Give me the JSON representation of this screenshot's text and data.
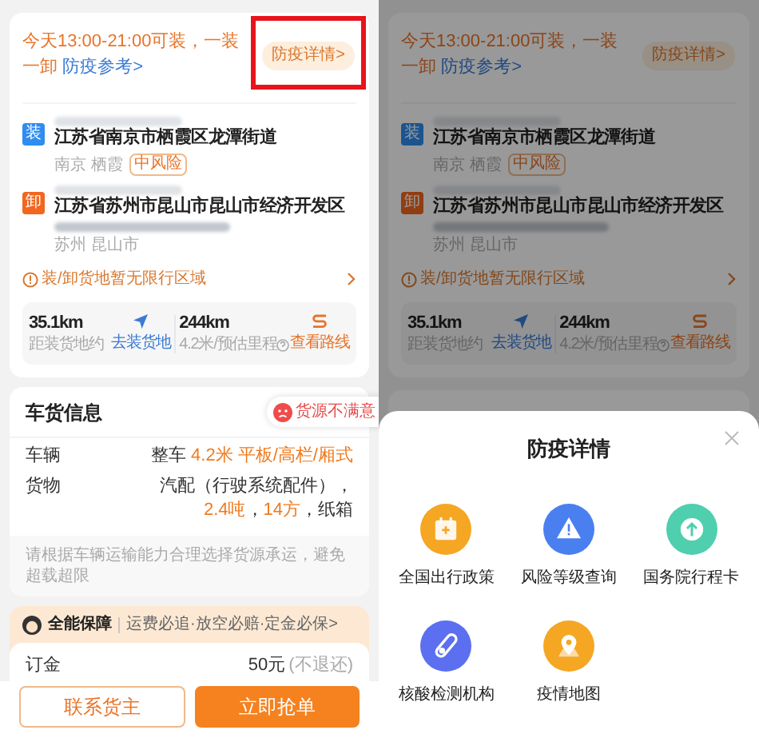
{
  "left": {
    "route_card": {
      "time_text": "今天13:00-21:00可装，一装一卸 ",
      "reference_link": "防疫参考>",
      "epidemic_badge": {
        "label": "防疫详情>",
        "highlighted": true
      },
      "stops": [
        {
          "kind": "load",
          "tag": "装",
          "address": "江苏省南京市栖霞区龙潭街道",
          "area": "南京 栖霞",
          "risk": "中风险"
        },
        {
          "kind": "unload",
          "tag": "卸",
          "address": "江苏省苏州市昆山市昆山市经济开发区",
          "area": "苏州 昆山市"
        }
      ],
      "notice": "装/卸货地暂无限行区域",
      "stats": {
        "distance": "35.1km",
        "distance_label": "距装货地约",
        "navigate": "去装货地",
        "mileage": "244km",
        "mileage_label": "4.2米/预估里程",
        "route": "查看路线"
      }
    },
    "cargo_card": {
      "title": "车货信息",
      "feedback": "货源不满意",
      "rows": [
        {
          "label": "车辆",
          "value": [
            {
              "text": "整车 ",
              "accent": false
            },
            {
              "text": "4.2米 平板/高栏/厢式",
              "accent": true
            }
          ]
        },
        {
          "label": "货物",
          "value": [
            {
              "text": "汽配（行驶系统配件），",
              "accent": false
            },
            {
              "text": "2.4吨",
              "accent": true
            },
            {
              "text": "，",
              "accent": false
            },
            {
              "text": "14方",
              "accent": true
            },
            {
              "text": "，纸箱",
              "accent": false
            }
          ]
        }
      ],
      "note": "请根据车辆运输能力合理选择货源承运，避免超载超限"
    },
    "guarantee": {
      "title": "全能保障",
      "slogan": "运费必追·放空必赔·定金必保>",
      "deposit_label": "订金",
      "deposit_value": "50元",
      "deposit_note": "(不退还)"
    },
    "buttons": [
      {
        "kind": "outline",
        "label": "联系货主"
      },
      {
        "kind": "primary",
        "label": "立即抢单"
      }
    ]
  },
  "right": {
    "route_card": {
      "time_text": "今天13:00-21:00可装，一装一卸 ",
      "reference_link": "防疫参考>",
      "epidemic_badge": {
        "label": "防疫详情>",
        "highlighted": false
      },
      "stops": [
        {
          "kind": "load",
          "tag": "装",
          "address": "江苏省南京市栖霞区龙潭街道",
          "area": "南京 栖霞",
          "risk": "中风险"
        },
        {
          "kind": "unload",
          "tag": "卸",
          "address": "江苏省苏州市昆山市昆山市经济开发区",
          "area": "苏州 昆山市"
        }
      ],
      "notice": "装/卸货地暂无限行区域",
      "stats": {
        "distance": "35.1km",
        "distance_label": "距装货地约",
        "navigate": "去装货地",
        "mileage": "244km",
        "mileage_label": "4.2米/预估里程",
        "route": "查看路线"
      }
    },
    "sheet": {
      "title": "防疫详情",
      "items": [
        {
          "kind": "calendar",
          "label": "全国出行政策",
          "color": "#f5a623"
        },
        {
          "kind": "warning",
          "label": "风险等级查询",
          "color": "#4a7ff0"
        },
        {
          "kind": "arrow",
          "label": "国务院行程卡",
          "color": "#4fcfae"
        },
        {
          "kind": "tube",
          "label": "核酸检测机构",
          "color": "#5b6ff0"
        },
        {
          "kind": "pin",
          "label": "疫情地图",
          "color": "#f5a623"
        }
      ]
    }
  }
}
